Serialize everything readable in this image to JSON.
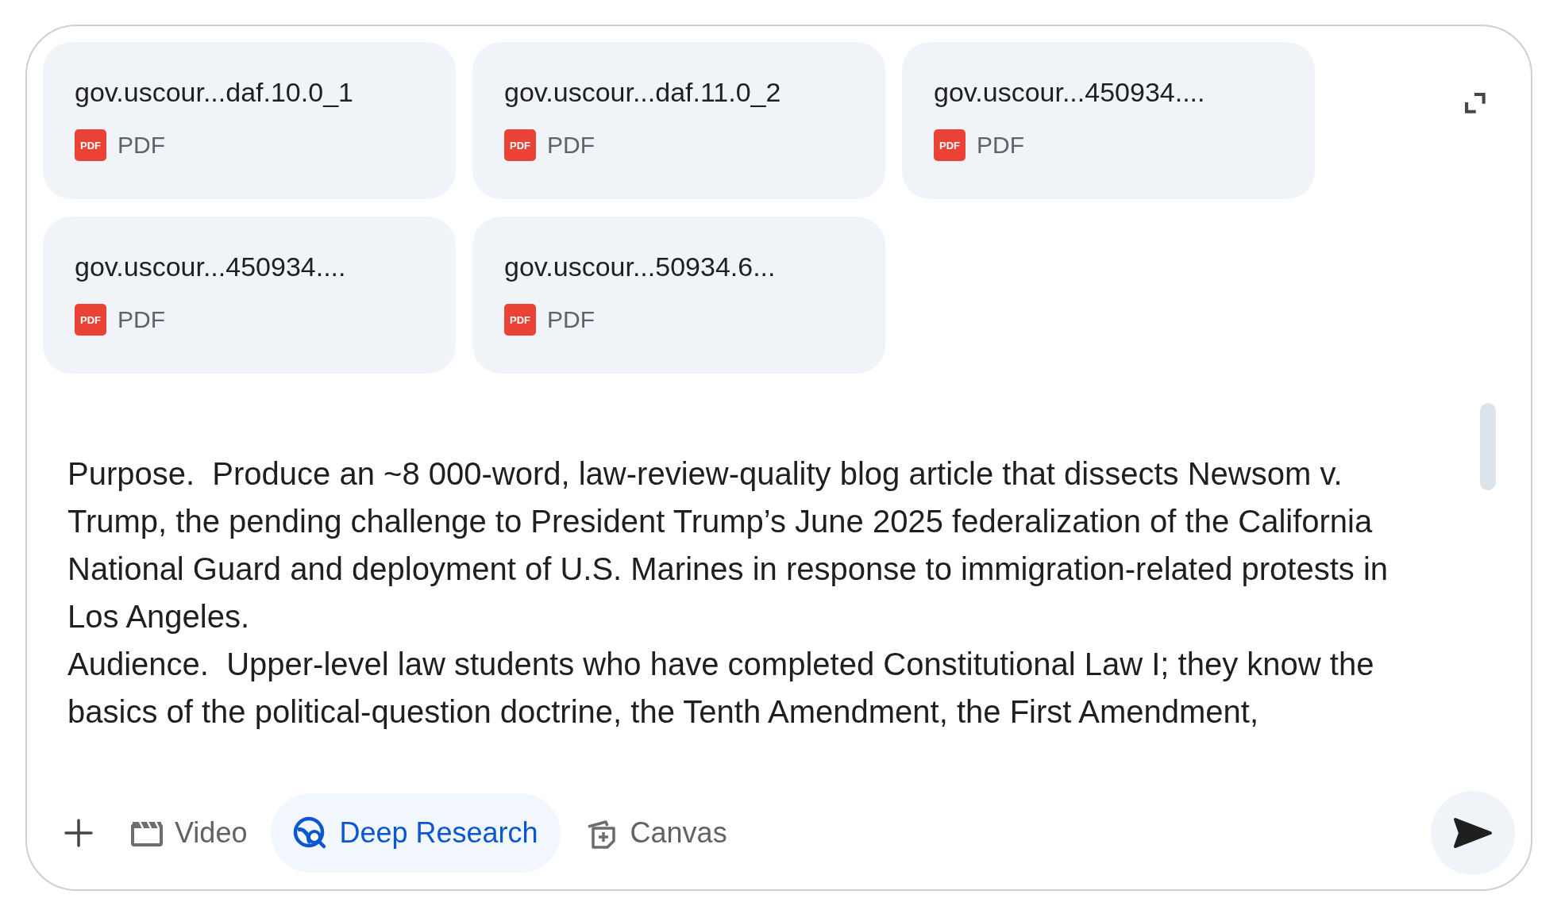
{
  "attachments": [
    {
      "name": "gov.uscour...daf.10.0_1",
      "icon_text": "PDF",
      "type": "PDF"
    },
    {
      "name": "gov.uscour...daf.11.0_2",
      "icon_text": "PDF",
      "type": "PDF"
    },
    {
      "name": "gov.uscour...450934....",
      "icon_text": "PDF",
      "type": "PDF"
    },
    {
      "name": "gov.uscour...450934....",
      "icon_text": "PDF",
      "type": "PDF"
    },
    {
      "name": "gov.uscour...50934.6...",
      "icon_text": "PDF",
      "type": "PDF"
    }
  ],
  "prompt": {
    "paragraphs": [
      "Purpose.  Produce an ~8 000-word, law-review-quality blog article that dissects Newsom v. Trump, the pending challenge to President Trump’s June 2025 federalization of the California National Guard and deployment of U.S. Marines in response to immigration-related protests in Los Angeles.",
      "Audience.  Upper-level law students who have completed Constitutional Law I; they know the basics of the political-question doctrine, the Tenth Amendment, the First Amendment,"
    ]
  },
  "tools": [
    {
      "kind": "add",
      "selected": false
    },
    {
      "kind": "video",
      "label": "Video",
      "selected": false
    },
    {
      "kind": "research",
      "label": "Deep Research",
      "selected": true
    },
    {
      "kind": "canvas",
      "label": "Canvas",
      "selected": false
    }
  ]
}
